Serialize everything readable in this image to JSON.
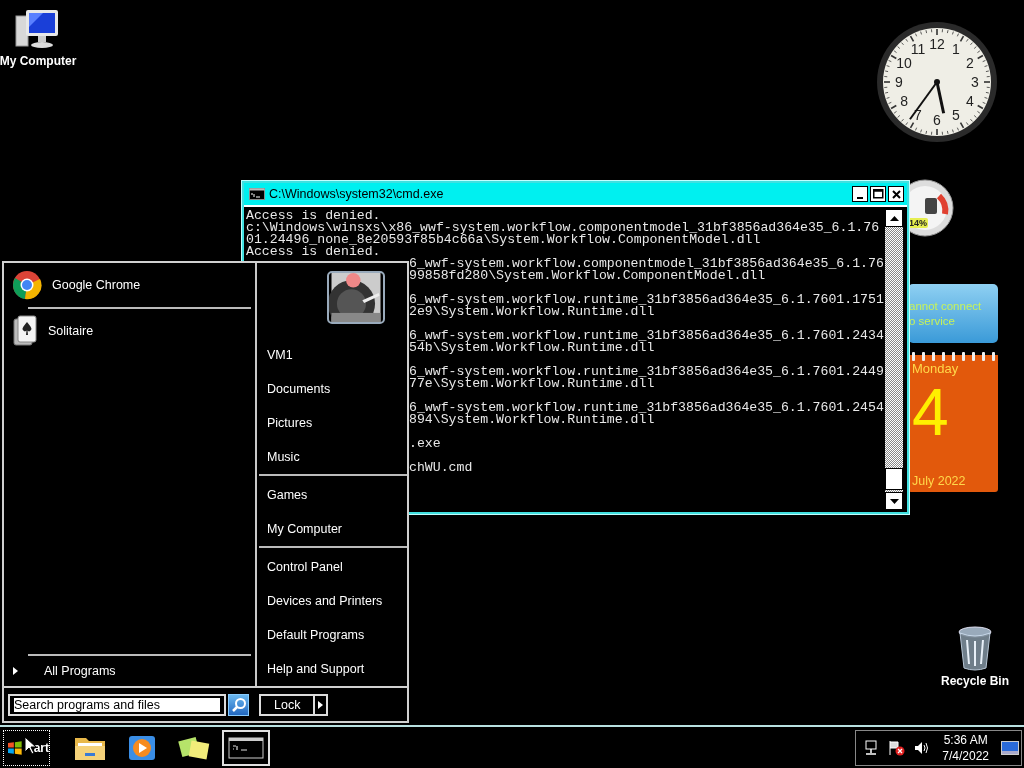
{
  "desktop_icons": [
    {
      "label": "My Computer",
      "kind": "computer"
    },
    {
      "label": "Recycle Bin",
      "kind": "recycle"
    }
  ],
  "gadgets": {
    "clock": {
      "kind": "analog",
      "numerals": [
        "12",
        "11",
        "1",
        "10",
        "2",
        "9",
        "3",
        "8",
        "4",
        "7",
        "5",
        "6"
      ]
    },
    "cpu_meter": {
      "reading": "14%"
    },
    "weather": {
      "message": [
        "annot connect",
        "o service"
      ]
    },
    "calendar": {
      "weekday": "Monday",
      "day": "4",
      "month_year": "July 2022"
    }
  },
  "cmd_window": {
    "title": "C:\\Windows\\system32\\cmd.exe",
    "blocks": [
      {
        "lines": [
          {
            "text": "Access is denied."
          },
          {
            "text": "c:\\Windows\\winsxs\\x86_wwf-system.workflow.componentmodel_31bf3856ad364e35_6.1.76"
          },
          {
            "text": "01.24496_none_8e20593f85b4c66a\\System.Workflow.ComponentModel.dll"
          },
          {
            "text": "Access is denied."
          },
          {
            "text": "6_wwf-system.workflow.componentmodel_31bf3856ad364e35_6.1.76",
            "clipped": true
          },
          {
            "text": "99858fd280\\System.Workflow.ComponentModel.dll",
            "clipped": true
          }
        ]
      },
      {
        "lines": [
          {
            "text": "6_wwf-system.workflow.runtime_31bf3856ad364e35_6.1.7601.1751",
            "clipped": true
          },
          {
            "text": "2e9\\System.Workflow.Runtime.dll",
            "clipped": true
          }
        ]
      },
      {
        "lines": [
          {
            "text": "6_wwf-system.workflow.runtime_31bf3856ad364e35_6.1.7601.2434",
            "clipped": true
          },
          {
            "text": "54b\\System.Workflow.Runtime.dll",
            "clipped": true
          }
        ]
      },
      {
        "lines": [
          {
            "text": "6_wwf-system.workflow.runtime_31bf3856ad364e35_6.1.7601.2449",
            "clipped": true
          },
          {
            "text": "77e\\System.Workflow.Runtime.dll",
            "clipped": true
          }
        ]
      },
      {
        "lines": [
          {
            "text": "6_wwf-system.workflow.runtime_31bf3856ad364e35_6.1.7601.2454",
            "clipped": true
          },
          {
            "text": "894\\System.Workflow.Runtime.dll",
            "clipped": true
          }
        ]
      },
      {
        "lines": [
          {
            "text": ".exe",
            "clipped": true
          }
        ]
      },
      {
        "lines": [
          {
            "text": "chWU.cmd",
            "clipped": true
          }
        ]
      }
    ]
  },
  "start_menu": {
    "pinned": [
      {
        "label": "Google Chrome",
        "kind": "chrome"
      },
      {
        "label": "Solitaire",
        "kind": "solitaire"
      }
    ],
    "all_programs": "All Programs",
    "search": {
      "placeholder": "Search programs and files"
    },
    "places": [
      [
        "VM1",
        "Documents",
        "Pictures",
        "Music"
      ],
      [
        "Games",
        "My Computer"
      ],
      [
        "Control Panel",
        "Devices and Printers",
        "Default Programs",
        "Help and Support"
      ]
    ],
    "lock_button": "Lock"
  },
  "taskbar": {
    "start_label": "art",
    "apps": [
      {
        "kind": "folder",
        "selected": false
      },
      {
        "kind": "media",
        "selected": false
      },
      {
        "kind": "notes",
        "selected": false
      },
      {
        "kind": "cmd",
        "selected": true
      }
    ],
    "clock": {
      "time": "5:36 AM",
      "date": "7/4/2022"
    }
  }
}
